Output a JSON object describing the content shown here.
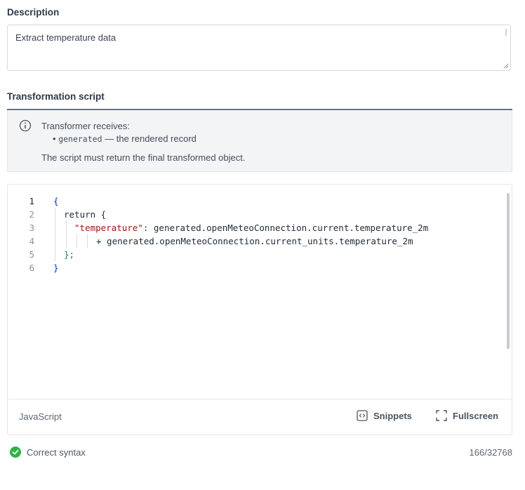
{
  "description": {
    "label": "Description",
    "value": "Extract temperature data"
  },
  "transformation": {
    "label": "Transformation script",
    "info": {
      "icon": "info-icon",
      "line1": "Transformer receives:",
      "bullet": "•",
      "item_code": "generated",
      "item_text": " — the rendered record",
      "line3": "The script must return the final transformed object."
    },
    "code_lines": [
      {
        "number": "1",
        "text": "{"
      },
      {
        "number": "2",
        "text": "return {"
      },
      {
        "number": "3",
        "key": "\"temperature\"",
        "text": ": generated.openMeteoConnection.current.temperature_2m"
      },
      {
        "number": "4",
        "text": "+ generated.openMeteoConnection.current_units.temperature_2m"
      },
      {
        "number": "5",
        "text": "};"
      },
      {
        "number": "6",
        "text": "}"
      }
    ],
    "footer": {
      "language": "JavaScript",
      "snippets_label": "Snippets",
      "fullscreen_label": "Fullscreen"
    }
  },
  "status": {
    "text": "Correct syntax",
    "color": "#2fb344",
    "char_count": "166/32768"
  }
}
